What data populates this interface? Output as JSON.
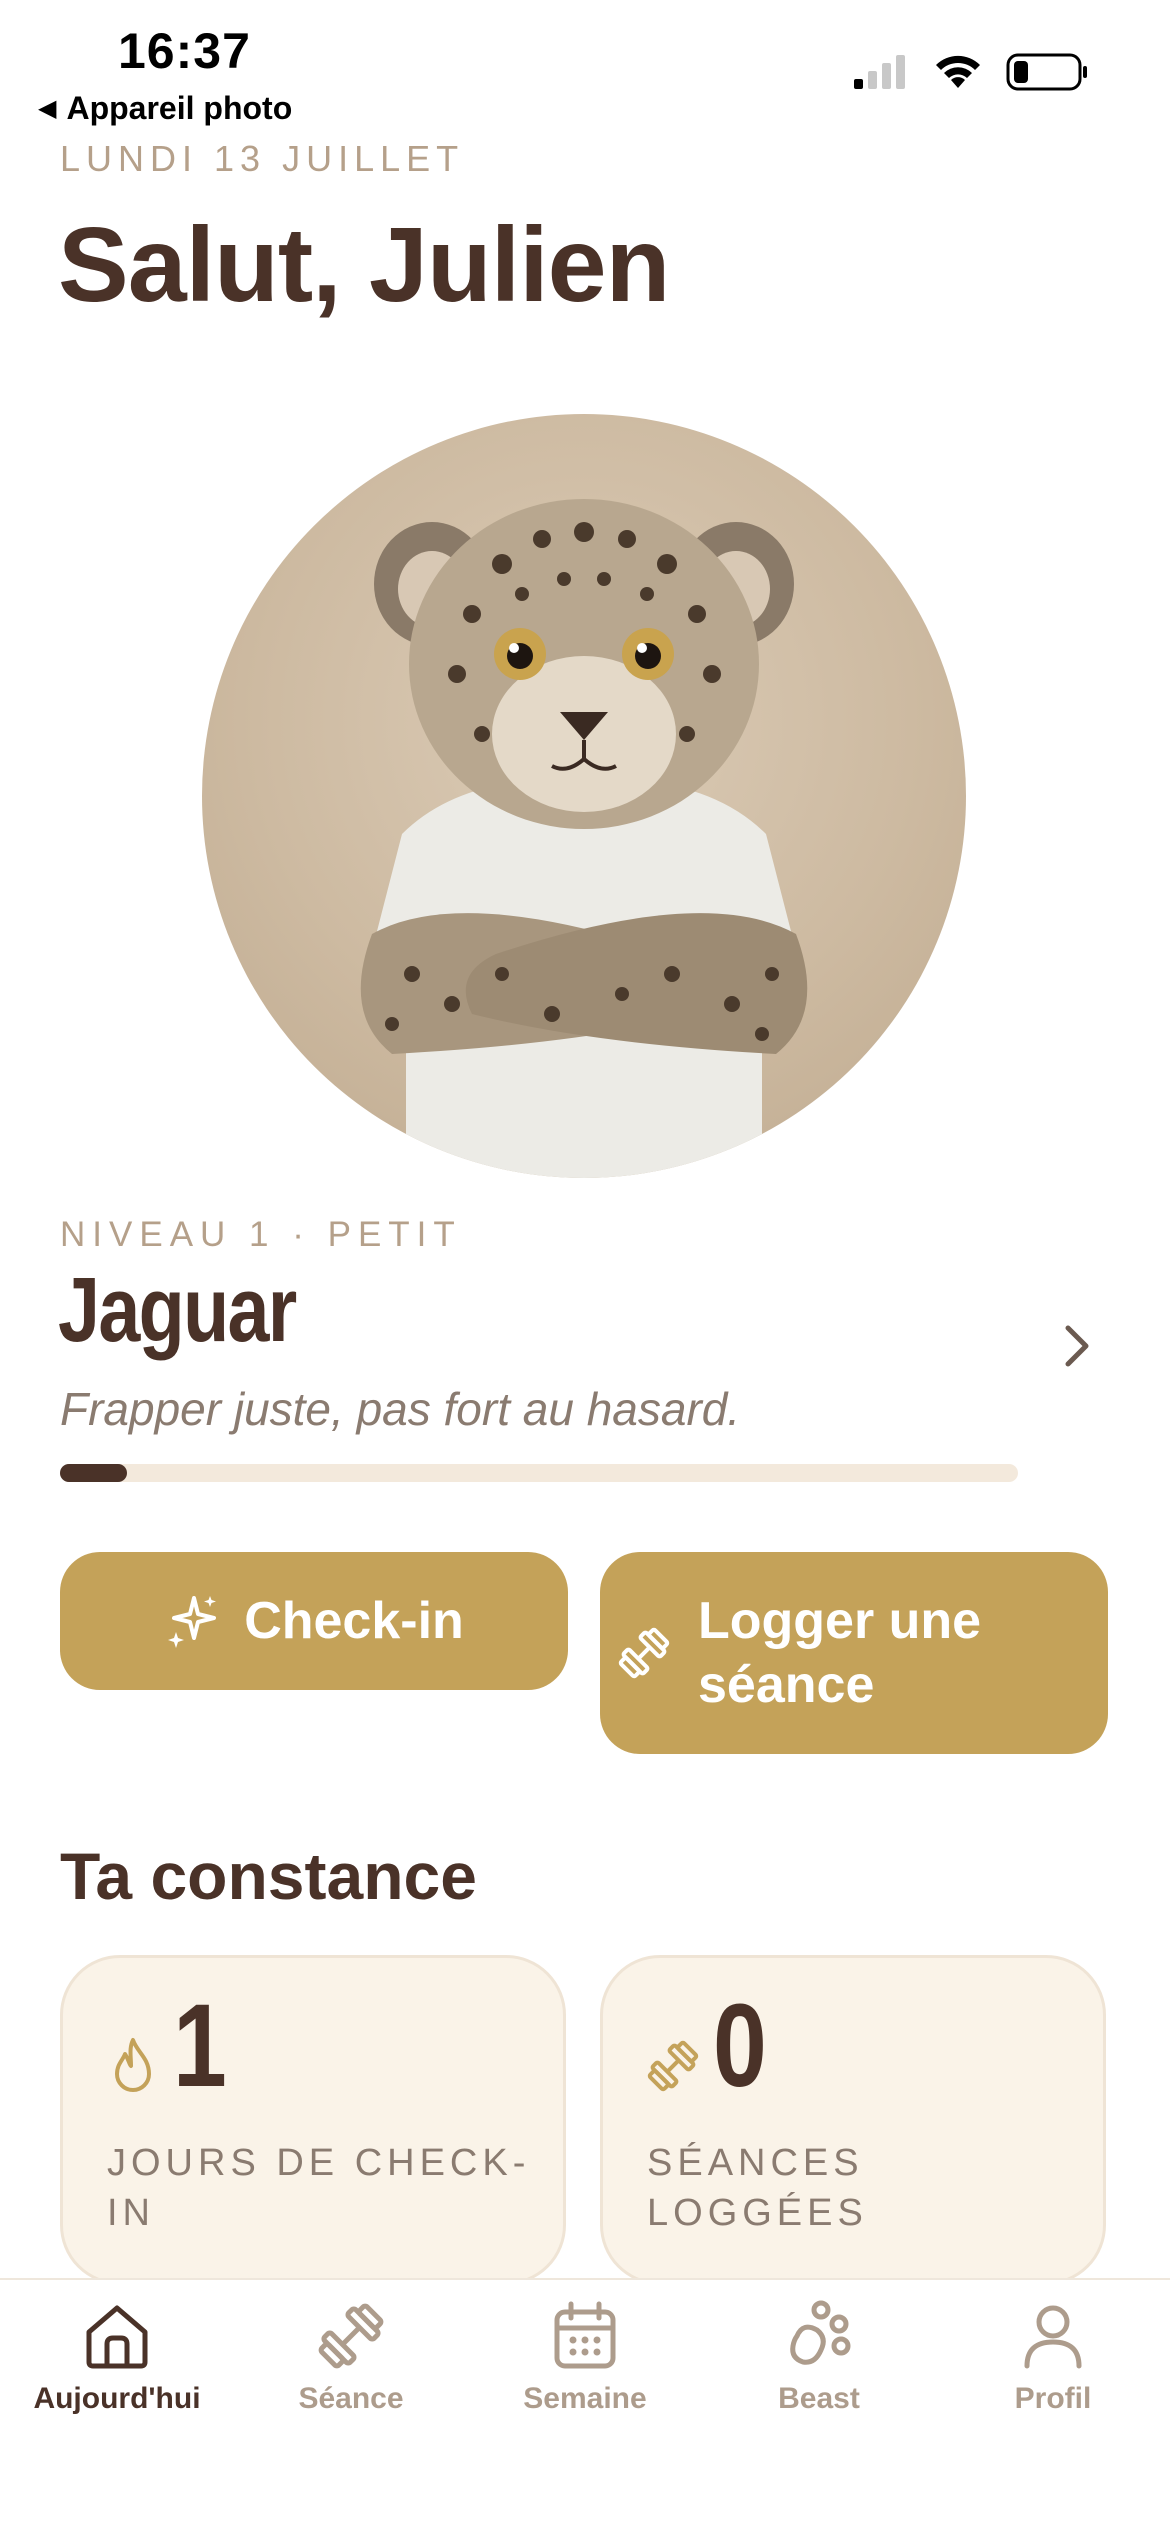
{
  "status_bar": {
    "time": "16:37",
    "back_app": "Appareil photo",
    "back_arrow": "◀"
  },
  "header": {
    "date": "LUNDI 13 JUILLET",
    "greeting": "Salut, Julien"
  },
  "beast": {
    "level_label": "NIVEAU 1 · PETIT",
    "name": "Jaguar",
    "motto": "Frapper juste, pas fort au hasard.",
    "progress": 0.07
  },
  "actions": {
    "checkin_label": "Check-in",
    "log_label_line1": "Logger une",
    "log_label_line2": "séance"
  },
  "constancy": {
    "title": "Ta constance",
    "stats": [
      {
        "value": "1",
        "label": "JOURS DE CHECK-IN",
        "icon": "flame-icon"
      },
      {
        "value": "0",
        "label": "SÉANCES LOGGÉES",
        "icon": "dumbbell-icon"
      }
    ]
  },
  "tabs": [
    {
      "label": "Aujourd'hui",
      "icon": "home-icon",
      "active": true
    },
    {
      "label": "Séance",
      "icon": "dumbbell-icon",
      "active": false
    },
    {
      "label": "Semaine",
      "icon": "calendar-icon",
      "active": false
    },
    {
      "label": "Beast",
      "icon": "paw-icon",
      "active": false
    },
    {
      "label": "Profil",
      "icon": "user-icon",
      "active": false
    }
  ],
  "colors": {
    "brown": "#4a3228",
    "gold": "#c4a259",
    "muted": "#b5a08a",
    "card": "#faf3e8"
  }
}
